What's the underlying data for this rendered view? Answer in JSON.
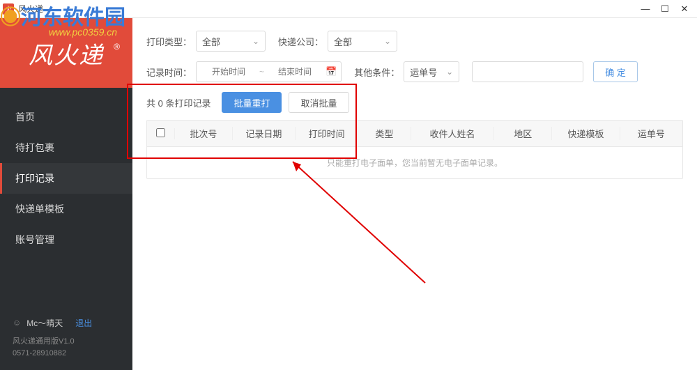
{
  "window": {
    "title": "风火递"
  },
  "watermark": {
    "text": "河东软件园",
    "url": "www.pc0359.cn"
  },
  "logo": {
    "text": "风火递",
    "reg": "®"
  },
  "sidebar": {
    "items": [
      {
        "label": "首页"
      },
      {
        "label": "待打包裹"
      },
      {
        "label": "打印记录"
      },
      {
        "label": "快递单模板"
      },
      {
        "label": "账号管理"
      }
    ]
  },
  "footer": {
    "user": "Mc～晴天",
    "logout": "退出",
    "version": "风火递通用版V1.0",
    "phone": "0571-28910882"
  },
  "filters": {
    "print_type_label": "打印类型：",
    "print_type_value": "全部",
    "courier_label": "快递公司：",
    "courier_value": "全部",
    "record_time_label": "记录时间：",
    "start_placeholder": "开始时间",
    "end_placeholder": "结束时间",
    "other_cond_label": "其他条件：",
    "other_cond_value": "运单号",
    "confirm": "确 定"
  },
  "summary": {
    "text": "共 0 条打印记录",
    "batch_reprint": "批量重打",
    "cancel_batch": "取消批量"
  },
  "table": {
    "headers": [
      "批次号",
      "记录日期",
      "打印时间",
      "类型",
      "收件人姓名",
      "地区",
      "快递模板",
      "运单号"
    ],
    "empty": "只能重打电子面单，您当前暂无电子面单记录。"
  }
}
